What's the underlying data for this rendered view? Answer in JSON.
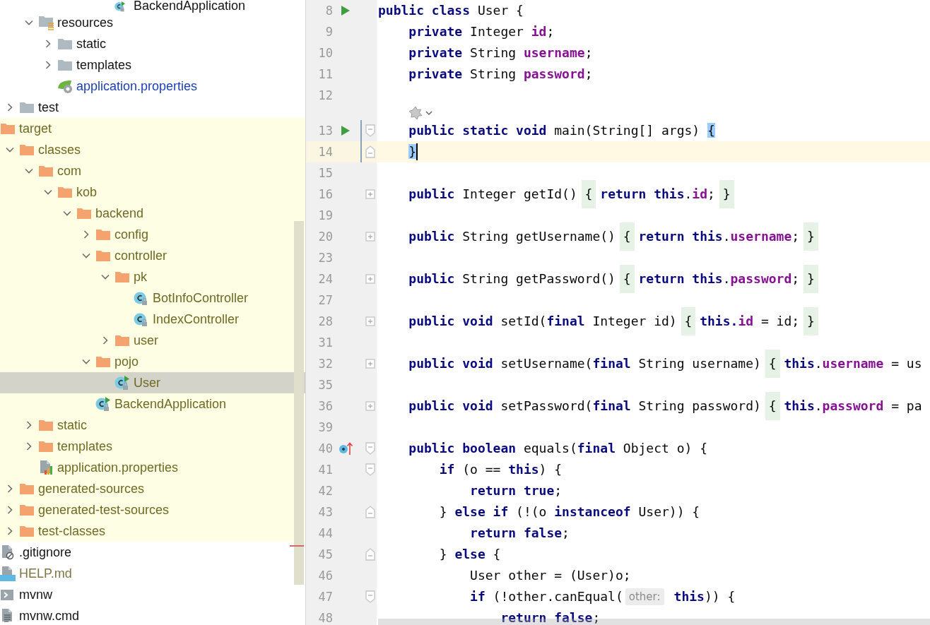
{
  "project_tree": [
    {
      "children": [
        {
          "children": [
            {
              "children": [
                {
                  "children": [
                    {
                      "children": [
                        {
                          "children": [
                            {
                              "name": "BackendApplication",
                              "kind": "runnable-class",
                              "selected": false,
                              "excluded": false,
                              "color": "#141414"
                            }
                          ]
                        }
                      ]
                    }
                  ]
                }
              ]
            },
            {
              "name": "resources",
              "kind": "resources-folder",
              "expanded": true,
              "selected": false,
              "excluded": false,
              "color": "#141414",
              "children": [
                {
                  "name": "static",
                  "kind": "folder",
                  "expanded": false,
                  "selected": false,
                  "excluded": false,
                  "color": "#141414"
                },
                {
                  "name": "templates",
                  "kind": "folder",
                  "expanded": false,
                  "selected": false,
                  "excluded": false,
                  "color": "#141414"
                },
                {
                  "name": "application.properties",
                  "kind": "spring-properties",
                  "selected": false,
                  "excluded": false,
                  "color": "#1b3fb0"
                }
              ]
            }
          ]
        },
        {
          "name": "test",
          "kind": "folder",
          "expanded": false,
          "selected": false,
          "excluded": false,
          "color": "#141414"
        }
      ]
    },
    {
      "name": "target",
      "kind": "excluded-folder",
      "selected": false,
      "excluded": true,
      "color": "#6f6a24",
      "children": [
        {
          "name": "classes",
          "kind": "excluded-folder",
          "expanded": true,
          "selected": false,
          "excluded": true,
          "color": "#6f6a24",
          "children": [
            {
              "name": "com",
              "kind": "excluded-folder",
              "expanded": true,
              "selected": false,
              "excluded": true,
              "color": "#6f6a24",
              "children": [
                {
                  "name": "kob",
                  "kind": "excluded-folder",
                  "expanded": true,
                  "selected": false,
                  "excluded": true,
                  "color": "#6f6a24",
                  "children": [
                    {
                      "name": "backend",
                      "kind": "excluded-folder",
                      "expanded": true,
                      "selected": false,
                      "excluded": true,
                      "color": "#6f6a24",
                      "children": [
                        {
                          "name": "config",
                          "kind": "excluded-folder",
                          "expanded": false,
                          "selected": false,
                          "excluded": true,
                          "color": "#6f6a24"
                        },
                        {
                          "name": "controller",
                          "kind": "excluded-folder",
                          "expanded": true,
                          "selected": false,
                          "excluded": true,
                          "color": "#6f6a24",
                          "children": [
                            {
                              "name": "pk",
                              "kind": "excluded-folder",
                              "expanded": true,
                              "selected": false,
                              "excluded": true,
                              "color": "#6f6a24",
                              "children": [
                                {
                                  "name": "BotInfoController",
                                  "kind": "class",
                                  "selected": false,
                                  "excluded": true,
                                  "color": "#6f6a24"
                                },
                                {
                                  "name": "IndexController",
                                  "kind": "class",
                                  "selected": false,
                                  "excluded": true,
                                  "color": "#6f6a24"
                                }
                              ]
                            },
                            {
                              "name": "user",
                              "kind": "excluded-folder",
                              "expanded": false,
                              "selected": false,
                              "excluded": true,
                              "color": "#6f6a24"
                            }
                          ]
                        },
                        {
                          "name": "pojo",
                          "kind": "excluded-folder",
                          "expanded": true,
                          "selected": false,
                          "excluded": true,
                          "color": "#6f6a24",
                          "children": [
                            {
                              "name": "User",
                              "kind": "runnable-class",
                              "selected": true,
                              "excluded": true,
                              "color": "#6f6a24"
                            }
                          ]
                        },
                        {
                          "name": "BackendApplication",
                          "kind": "runnable-class",
                          "selected": false,
                          "excluded": true,
                          "color": "#6f6a24"
                        }
                      ]
                    }
                  ]
                }
              ]
            },
            {
              "name": "static",
              "kind": "excluded-folder",
              "expanded": false,
              "selected": false,
              "excluded": true,
              "color": "#6f6a24"
            },
            {
              "name": "templates",
              "kind": "excluded-folder",
              "expanded": false,
              "selected": false,
              "excluded": true,
              "color": "#6f6a24"
            },
            {
              "name": "application.properties",
              "kind": "properties",
              "selected": false,
              "excluded": true,
              "color": "#6f6a24"
            }
          ]
        },
        {
          "name": "generated-sources",
          "kind": "excluded-folder",
          "expanded": false,
          "selected": false,
          "excluded": true,
          "color": "#6f6a24"
        },
        {
          "name": "generated-test-sources",
          "kind": "excluded-folder",
          "expanded": false,
          "selected": false,
          "excluded": true,
          "color": "#6f6a24"
        },
        {
          "name": "test-classes",
          "kind": "excluded-folder",
          "expanded": false,
          "selected": false,
          "excluded": true,
          "color": "#6f6a24"
        }
      ]
    },
    {
      "name": ".gitignore",
      "kind": "gitignore",
      "selected": false,
      "excluded": false,
      "color": "#141414"
    },
    {
      "name": "HELP.md",
      "kind": "markdown",
      "selected": false,
      "excluded": false,
      "color": "#7f7444"
    },
    {
      "name": "mvnw",
      "kind": "shell",
      "selected": false,
      "excluded": false,
      "color": "#141414"
    },
    {
      "name": "mvnw.cmd",
      "kind": "text",
      "selected": false,
      "excluded": false,
      "color": "#141414"
    }
  ],
  "lines": [
    {
      "kind": "code",
      "number": "8",
      "gutter_icon": {
        "kind": "run"
      },
      "current": false,
      "changed": false,
      "segments": [
        {
          "kind": "keyword",
          "text": "public class"
        },
        {
          "kind": "plain",
          "text": " User {"
        }
      ]
    },
    {
      "kind": "code",
      "number": "9",
      "current": false,
      "changed": false,
      "segments": [
        {
          "kind": "keyword",
          "text": "    private"
        },
        {
          "kind": "plain",
          "text": " Integer "
        },
        {
          "kind": "field",
          "text": "id"
        },
        {
          "kind": "plain",
          "text": ";"
        }
      ]
    },
    {
      "kind": "code",
      "number": "10",
      "current": false,
      "changed": false,
      "segments": [
        {
          "kind": "keyword",
          "text": "    private"
        },
        {
          "kind": "plain",
          "text": " String "
        },
        {
          "kind": "field",
          "text": "username"
        },
        {
          "kind": "plain",
          "text": ";"
        }
      ]
    },
    {
      "kind": "code",
      "number": "11",
      "current": false,
      "changed": false,
      "segments": [
        {
          "kind": "keyword",
          "text": "    private"
        },
        {
          "kind": "plain",
          "text": " String "
        },
        {
          "kind": "field",
          "text": "password"
        },
        {
          "kind": "plain",
          "text": ";"
        }
      ]
    },
    {
      "kind": "code",
      "number": "12",
      "current": false,
      "changed": false
    },
    {
      "kind": "code-vision",
      "current": false,
      "changed": false
    },
    {
      "kind": "code",
      "number": "13",
      "gutter_icon": {
        "kind": "run"
      },
      "fold_marker": {
        "kind": "start"
      },
      "current": false,
      "changed": true,
      "segments": [
        {
          "kind": "keyword",
          "text": "    public static void"
        },
        {
          "kind": "plain",
          "text": " main(String[] args) "
        },
        {
          "kind": "match",
          "text": "{"
        }
      ]
    },
    {
      "kind": "code",
      "number": "14",
      "fold_marker": {
        "kind": "end"
      },
      "current": true,
      "changed": true,
      "segments": [
        {
          "kind": "match",
          "text": "    }",
          "caret": true
        }
      ]
    },
    {
      "kind": "code",
      "number": "15",
      "current": false,
      "changed": false
    },
    {
      "kind": "code",
      "number": "16",
      "fold_marker": {
        "kind": "folded"
      },
      "current": false,
      "changed": false,
      "segments": [
        {
          "kind": "keyword",
          "text": "    public"
        },
        {
          "kind": "plain",
          "text": " Integer getId() "
        },
        {
          "kind": "fold",
          "text": "{"
        },
        {
          "kind": "keyword",
          "text": " return this"
        },
        {
          "kind": "plain",
          "text": "."
        },
        {
          "kind": "field",
          "text": "id"
        },
        {
          "kind": "plain",
          "text": "; "
        },
        {
          "kind": "fold",
          "text": "}"
        }
      ]
    },
    {
      "kind": "code",
      "number": "19",
      "current": false,
      "changed": false
    },
    {
      "kind": "code",
      "number": "20",
      "fold_marker": {
        "kind": "folded"
      },
      "current": false,
      "changed": false,
      "segments": [
        {
          "kind": "keyword",
          "text": "    public"
        },
        {
          "kind": "plain",
          "text": " String getUsername() "
        },
        {
          "kind": "fold",
          "text": "{"
        },
        {
          "kind": "keyword",
          "text": " return this"
        },
        {
          "kind": "plain",
          "text": "."
        },
        {
          "kind": "field",
          "text": "username"
        },
        {
          "kind": "plain",
          "text": "; "
        },
        {
          "kind": "fold",
          "text": "}"
        }
      ]
    },
    {
      "kind": "code",
      "number": "23",
      "current": false,
      "changed": false
    },
    {
      "kind": "code",
      "number": "24",
      "fold_marker": {
        "kind": "folded"
      },
      "current": false,
      "changed": false,
      "segments": [
        {
          "kind": "keyword",
          "text": "    public"
        },
        {
          "kind": "plain",
          "text": " String getPassword() "
        },
        {
          "kind": "fold",
          "text": "{"
        },
        {
          "kind": "keyword",
          "text": " return this"
        },
        {
          "kind": "plain",
          "text": "."
        },
        {
          "kind": "field",
          "text": "password"
        },
        {
          "kind": "plain",
          "text": "; "
        },
        {
          "kind": "fold",
          "text": "}"
        }
      ]
    },
    {
      "kind": "code",
      "number": "27",
      "current": false,
      "changed": false
    },
    {
      "kind": "code",
      "number": "28",
      "fold_marker": {
        "kind": "folded"
      },
      "current": false,
      "changed": false,
      "segments": [
        {
          "kind": "keyword",
          "text": "    public void"
        },
        {
          "kind": "plain",
          "text": " setId("
        },
        {
          "kind": "keyword",
          "text": "final"
        },
        {
          "kind": "plain",
          "text": " Integer id) "
        },
        {
          "kind": "fold",
          "text": "{"
        },
        {
          "kind": "keyword",
          "text": " this."
        },
        {
          "kind": "field",
          "text": "id"
        },
        {
          "kind": "plain",
          "text": " = id; "
        },
        {
          "kind": "fold",
          "text": "}"
        }
      ]
    },
    {
      "kind": "code",
      "number": "31",
      "current": false,
      "changed": false
    },
    {
      "kind": "code",
      "number": "32",
      "fold_marker": {
        "kind": "folded"
      },
      "current": false,
      "changed": false,
      "segments": [
        {
          "kind": "keyword",
          "text": "    public void"
        },
        {
          "kind": "plain",
          "text": " setUsername("
        },
        {
          "kind": "keyword",
          "text": "final"
        },
        {
          "kind": "plain",
          "text": " String username) "
        },
        {
          "kind": "fold",
          "text": "{"
        },
        {
          "kind": "keyword",
          "text": " this"
        },
        {
          "kind": "plain",
          "text": "."
        },
        {
          "kind": "field",
          "text": "username"
        },
        {
          "kind": "plain",
          "text": " = us"
        }
      ]
    },
    {
      "kind": "code",
      "number": "35",
      "current": false,
      "changed": false
    },
    {
      "kind": "code",
      "number": "36",
      "fold_marker": {
        "kind": "folded"
      },
      "current": false,
      "changed": false,
      "segments": [
        {
          "kind": "keyword",
          "text": "    public void"
        },
        {
          "kind": "plain",
          "text": " setPassword("
        },
        {
          "kind": "keyword",
          "text": "final"
        },
        {
          "kind": "plain",
          "text": " String password) "
        },
        {
          "kind": "fold",
          "text": "{"
        },
        {
          "kind": "keyword",
          "text": " this"
        },
        {
          "kind": "plain",
          "text": "."
        },
        {
          "kind": "field",
          "text": "password"
        },
        {
          "kind": "plain",
          "text": " = pa"
        }
      ]
    },
    {
      "kind": "code",
      "number": "39",
      "current": false,
      "changed": false
    },
    {
      "kind": "code",
      "number": "40",
      "gutter_icon": {
        "kind": "override"
      },
      "fold_marker": {
        "kind": "start"
      },
      "current": false,
      "changed": false,
      "segments": [
        {
          "kind": "keyword",
          "text": "    public boolean"
        },
        {
          "kind": "plain",
          "text": " equals("
        },
        {
          "kind": "keyword",
          "text": "final"
        },
        {
          "kind": "plain",
          "text": " Object o) {"
        }
      ]
    },
    {
      "kind": "code",
      "number": "41",
      "fold_marker": {
        "kind": "start"
      },
      "current": false,
      "changed": false,
      "segments": [
        {
          "kind": "keyword",
          "text": "        if"
        },
        {
          "kind": "plain",
          "text": " (o == "
        },
        {
          "kind": "keyword",
          "text": "this"
        },
        {
          "kind": "plain",
          "text": ") {"
        }
      ]
    },
    {
      "kind": "code",
      "number": "42",
      "current": false,
      "changed": false,
      "segments": [
        {
          "kind": "keyword",
          "text": "            return true"
        },
        {
          "kind": "plain",
          "text": ";"
        }
      ]
    },
    {
      "kind": "code",
      "number": "43",
      "fold_marker": {
        "kind": "end"
      },
      "current": false,
      "changed": false,
      "segments": [
        {
          "kind": "plain",
          "text": "        } "
        },
        {
          "kind": "keyword",
          "text": "else if"
        },
        {
          "kind": "plain",
          "text": " (!(o "
        },
        {
          "kind": "keyword",
          "text": "instanceof"
        },
        {
          "kind": "plain",
          "text": " User)) {"
        }
      ]
    },
    {
      "kind": "code",
      "number": "44",
      "current": false,
      "changed": false,
      "segments": [
        {
          "kind": "keyword",
          "text": "            return false"
        },
        {
          "kind": "plain",
          "text": ";"
        }
      ]
    },
    {
      "kind": "code",
      "number": "45",
      "fold_marker": {
        "kind": "end"
      },
      "current": false,
      "changed": false,
      "segments": [
        {
          "kind": "plain",
          "text": "        } "
        },
        {
          "kind": "keyword",
          "text": "else"
        },
        {
          "kind": "plain",
          "text": " {"
        }
      ]
    },
    {
      "kind": "code",
      "number": "46",
      "current": false,
      "changed": false,
      "segments": [
        {
          "kind": "plain",
          "text": "            User other = (User)o;"
        }
      ]
    },
    {
      "kind": "code",
      "number": "47",
      "fold_marker": {
        "kind": "start"
      },
      "current": false,
      "changed": false,
      "segments": [
        {
          "kind": "keyword",
          "text": "            if"
        },
        {
          "kind": "plain",
          "text": " (!other.canEqual("
        },
        {
          "kind": "hint",
          "text": "other:"
        },
        {
          "kind": "keyword",
          "text": "this"
        },
        {
          "kind": "plain",
          "text": ")) {"
        }
      ]
    },
    {
      "kind": "code",
      "number": "48",
      "current": false,
      "changed": false,
      "segments": [
        {
          "kind": "keyword",
          "text": "                return false"
        },
        {
          "kind": "plain",
          "text": ";"
        }
      ]
    }
  ]
}
